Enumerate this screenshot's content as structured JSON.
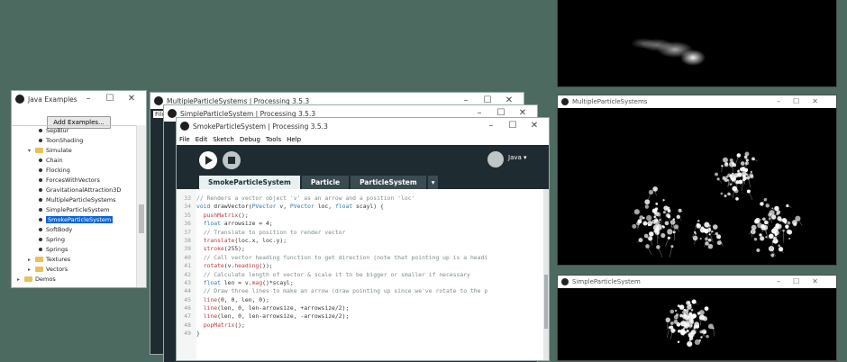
{
  "examples_window": {
    "title": "Java Examples",
    "add_button": "Add Examples...",
    "tree": [
      {
        "label": "SepBlur",
        "type": "leaf",
        "indent": 2
      },
      {
        "label": "ToonShading",
        "type": "leaf",
        "indent": 2
      },
      {
        "label": "Simulate",
        "type": "folder",
        "indent": 1,
        "expander": "▾"
      },
      {
        "label": "Chain",
        "type": "leaf",
        "indent": 2
      },
      {
        "label": "Flocking",
        "type": "leaf",
        "indent": 2
      },
      {
        "label": "ForcesWithVectors",
        "type": "leaf",
        "indent": 2
      },
      {
        "label": "GravitationalAttraction3D",
        "type": "leaf",
        "indent": 2
      },
      {
        "label": "MultipleParticleSystems",
        "type": "leaf",
        "indent": 2
      },
      {
        "label": "SimpleParticleSystem",
        "type": "leaf",
        "indent": 2
      },
      {
        "label": "SmokeParticleSystem",
        "type": "leaf",
        "indent": 2,
        "selected": true
      },
      {
        "label": "SoftBody",
        "type": "leaf",
        "indent": 2
      },
      {
        "label": "Spring",
        "type": "leaf",
        "indent": 2
      },
      {
        "label": "Springs",
        "type": "leaf",
        "indent": 2
      },
      {
        "label": "Textures",
        "type": "folder",
        "indent": 1,
        "expander": "▸"
      },
      {
        "label": "Vectors",
        "type": "folder",
        "indent": 1,
        "expander": "▸"
      },
      {
        "label": "Demos",
        "type": "folder",
        "indent": 0,
        "expander": "▸"
      }
    ]
  },
  "editor_windows": {
    "win1_title": "MultipleParticleSystems | Processing 3.5.3",
    "win2_title": "SimpleParticleSystem | Processing 3.5.3",
    "win3_title": "SmokeParticleSystem | Processing 3.5.3",
    "win1_menu_fragment": "File",
    "menu": [
      "File",
      "Edit",
      "Sketch",
      "Debug",
      "Tools",
      "Help"
    ],
    "mode": "Java ▾",
    "tabs": [
      "SmokeParticleSystem",
      "Particle",
      "ParticleSystem",
      "▾"
    ]
  },
  "code_lines": [
    {
      "n": "33",
      "parts": [
        {
          "c": "com",
          "t": "// Renders a vector object 'v' as an arrow and a position 'loc'"
        }
      ]
    },
    {
      "n": "34",
      "parts": [
        {
          "c": "kw",
          "t": "void "
        },
        {
          "c": "txt",
          "t": "drawVector("
        },
        {
          "c": "kw",
          "t": "PVector"
        },
        {
          "c": "txt",
          "t": " v, "
        },
        {
          "c": "kw",
          "t": "PVector"
        },
        {
          "c": "txt",
          "t": " loc, "
        },
        {
          "c": "kw",
          "t": "float"
        },
        {
          "c": "txt",
          "t": " scayl) {"
        }
      ]
    },
    {
      "n": "35",
      "parts": [
        {
          "c": "fn",
          "t": "  pushMatrix"
        },
        {
          "c": "txt",
          "t": "();"
        }
      ]
    },
    {
      "n": "36",
      "parts": [
        {
          "c": "kw",
          "t": "  float"
        },
        {
          "c": "txt",
          "t": " arrowsize = 4;"
        }
      ]
    },
    {
      "n": "37",
      "parts": [
        {
          "c": "com",
          "t": "  // Translate to position to render vector"
        }
      ]
    },
    {
      "n": "38",
      "parts": [
        {
          "c": "fn",
          "t": "  translate"
        },
        {
          "c": "txt",
          "t": "(loc.x, loc.y);"
        }
      ]
    },
    {
      "n": "39",
      "parts": [
        {
          "c": "fn",
          "t": "  stroke"
        },
        {
          "c": "txt",
          "t": "(255);"
        }
      ]
    },
    {
      "n": "40",
      "parts": [
        {
          "c": "com",
          "t": "  // Call vector heading function to get direction (note that pointing up is a headi"
        }
      ]
    },
    {
      "n": "41",
      "parts": [
        {
          "c": "fn",
          "t": "  rotate"
        },
        {
          "c": "txt",
          "t": "(v."
        },
        {
          "c": "fn",
          "t": "heading"
        },
        {
          "c": "txt",
          "t": "());"
        }
      ]
    },
    {
      "n": "42",
      "parts": [
        {
          "c": "com",
          "t": "  // Calculate length of vector & scale it to be bigger or smaller if necessary"
        }
      ]
    },
    {
      "n": "43",
      "parts": [
        {
          "c": "kw",
          "t": "  float"
        },
        {
          "c": "txt",
          "t": " len = v."
        },
        {
          "c": "fn",
          "t": "mag"
        },
        {
          "c": "txt",
          "t": "()*scayl;"
        }
      ]
    },
    {
      "n": "44",
      "parts": [
        {
          "c": "com",
          "t": "  // Draw three lines to make an arrow (draw pointing up since we've rotate to the p"
        }
      ]
    },
    {
      "n": "45",
      "parts": [
        {
          "c": "fn",
          "t": "  line"
        },
        {
          "c": "txt",
          "t": "(0, 0, len, 0);"
        }
      ]
    },
    {
      "n": "46",
      "parts": [
        {
          "c": "fn",
          "t": "  line"
        },
        {
          "c": "txt",
          "t": "(len, 0, len-arrowsize, +arrowsize/2);"
        }
      ]
    },
    {
      "n": "47",
      "parts": [
        {
          "c": "fn",
          "t": "  line"
        },
        {
          "c": "txt",
          "t": "(len, 0, len-arrowsize, -arrowsize/2);"
        }
      ]
    },
    {
      "n": "48",
      "parts": [
        {
          "c": "fn",
          "t": "  popMatrix"
        },
        {
          "c": "txt",
          "t": "();"
        }
      ]
    },
    {
      "n": "49",
      "parts": [
        {
          "c": "txt",
          "t": "}"
        }
      ]
    }
  ],
  "sketches": {
    "multiple_title": "MultipleParticleSystems",
    "simple_title": "SimpleParticleSystem"
  },
  "colors": {
    "desktop": "#4d6a60",
    "editor_dark": "#1e2b31",
    "selection": "#0a64d6"
  }
}
